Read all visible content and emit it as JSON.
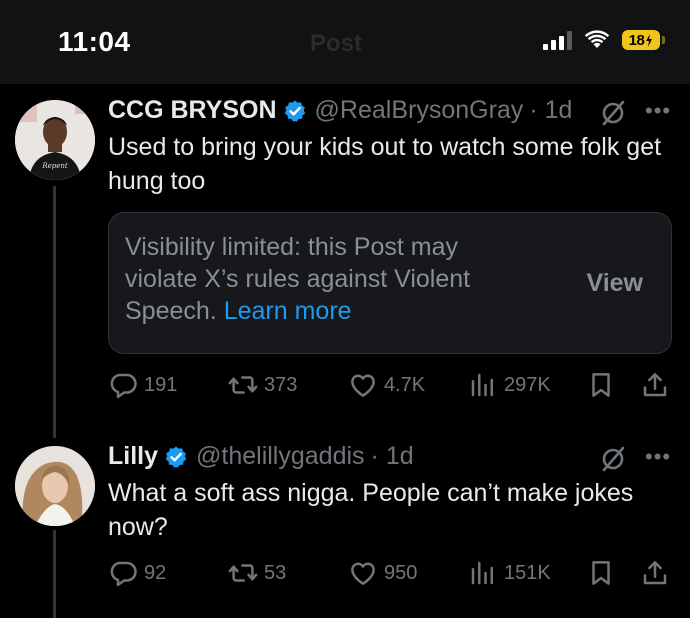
{
  "status_bar": {
    "time": "11:04",
    "faded_title": "Post",
    "battery": "18"
  },
  "tweets": [
    {
      "name": "CCG BRYSON",
      "handle": "@RealBrysonGray",
      "time": "· 1d",
      "text": "Used to bring your kids out to watch some folk get hung too",
      "notice": {
        "text": "Visibility limited: this Post may violate X’s rules against Violent Speech.",
        "link": "Learn more",
        "view": "View"
      },
      "replies": "191",
      "reposts": "373",
      "likes": "4.7K",
      "views": "297K"
    },
    {
      "name": "Lilly",
      "handle": "@thelillygaddis",
      "time": "· 1d",
      "text": "What a soft ass nigga. People can’t make jokes now?",
      "replies": "92",
      "reposts": "53",
      "likes": "950",
      "views": "151K"
    }
  ],
  "colors": {
    "background": "#000000",
    "text": "#e7e9ea",
    "muted": "#71767b",
    "verified": "#1d9bf0",
    "link": "#1d9bf0",
    "battery": "#f0c419"
  }
}
